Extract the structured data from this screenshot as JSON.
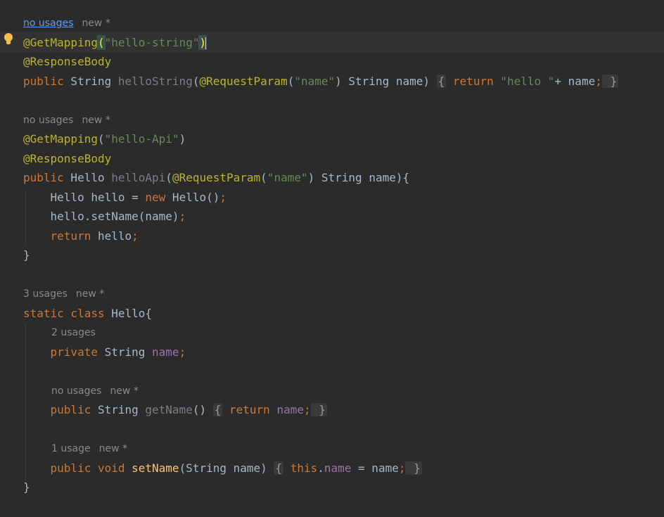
{
  "colors": {
    "background": "#2b2b2b",
    "annotation": "#bbb529",
    "string": "#6a8759",
    "keyword": "#cc7832",
    "field": "#9876aa",
    "method_decl": "#ffc66d",
    "hint": "#8a8a8a",
    "link": "#589df6"
  },
  "gutter": {
    "intention_icon": "lightbulb-icon"
  },
  "code": {
    "hint1": {
      "usages": "no usages",
      "new": "new *"
    },
    "l1": {
      "annotation": "@GetMapping",
      "open": "(",
      "string": "\"hello-string\"",
      "close": ")"
    },
    "l2": {
      "annotation": "@ResponseBody"
    },
    "l3": {
      "kw_public": "public",
      "type": " String ",
      "method": "helloString",
      "open": "(",
      "annotation": "@RequestParam",
      "ap_open": "(",
      "string": "\"name\"",
      "ap_close": ")",
      "params": " String name) ",
      "fold_open": "{",
      "kw_return": " return ",
      "ret_string": "\"hello \"",
      "rest": "+ name",
      "semi": ";",
      "fold_close": " }"
    },
    "hint2": {
      "usages": "no usages",
      "new": "new *"
    },
    "l5": {
      "annotation": "@GetMapping",
      "open": "(",
      "string": "\"hello-Api\"",
      "close": ")"
    },
    "l6": {
      "annotation": "@ResponseBody"
    },
    "l7": {
      "kw_public": "public",
      "type": " Hello ",
      "method": "helloApi",
      "open": "(",
      "annotation": "@RequestParam",
      "ap_open": "(",
      "string": "\"name\"",
      "ap_close": ")",
      "params": " String name){"
    },
    "l8": {
      "indent": "    ",
      "decl": "Hello hello = ",
      "kw_new": "new",
      "ctor": " Hello()",
      "semi": ";"
    },
    "l9": {
      "indent": "    ",
      "text": "hello.setName(name)",
      "semi": ";"
    },
    "l10": {
      "indent": "    ",
      "kw_return": "return",
      "text": " hello",
      "semi": ";"
    },
    "l11": {
      "text": "}"
    },
    "hint3": {
      "usages": "3 usages",
      "new": "new *"
    },
    "l13": {
      "kw_static": "static",
      "kw_class": " class",
      "text": " Hello{"
    },
    "hint4": {
      "usages": "2 usages"
    },
    "l14": {
      "indent": "    ",
      "kw_private": "private",
      "type": " String ",
      "field": "name",
      "semi": ";"
    },
    "hint5": {
      "usages": "no usages",
      "new": "new *"
    },
    "l16": {
      "indent": "    ",
      "kw_public": "public",
      "type": " String ",
      "method": "getName",
      "parens": "() ",
      "fold_open": "{",
      "kw_return": " return ",
      "field": "name",
      "semi": ";",
      "fold_close": " }"
    },
    "hint6": {
      "usages": "1 usage",
      "new": "new *"
    },
    "l18": {
      "indent": "    ",
      "kw_public": "public",
      "kw_void": " void ",
      "method": "setName",
      "params": "(String name) ",
      "fold_open": "{",
      "kw_this": " this",
      "dot": ".",
      "field": "name",
      "assign": " = name",
      "semi": ";",
      "fold_close": " }"
    },
    "l19": {
      "text": "}"
    }
  }
}
